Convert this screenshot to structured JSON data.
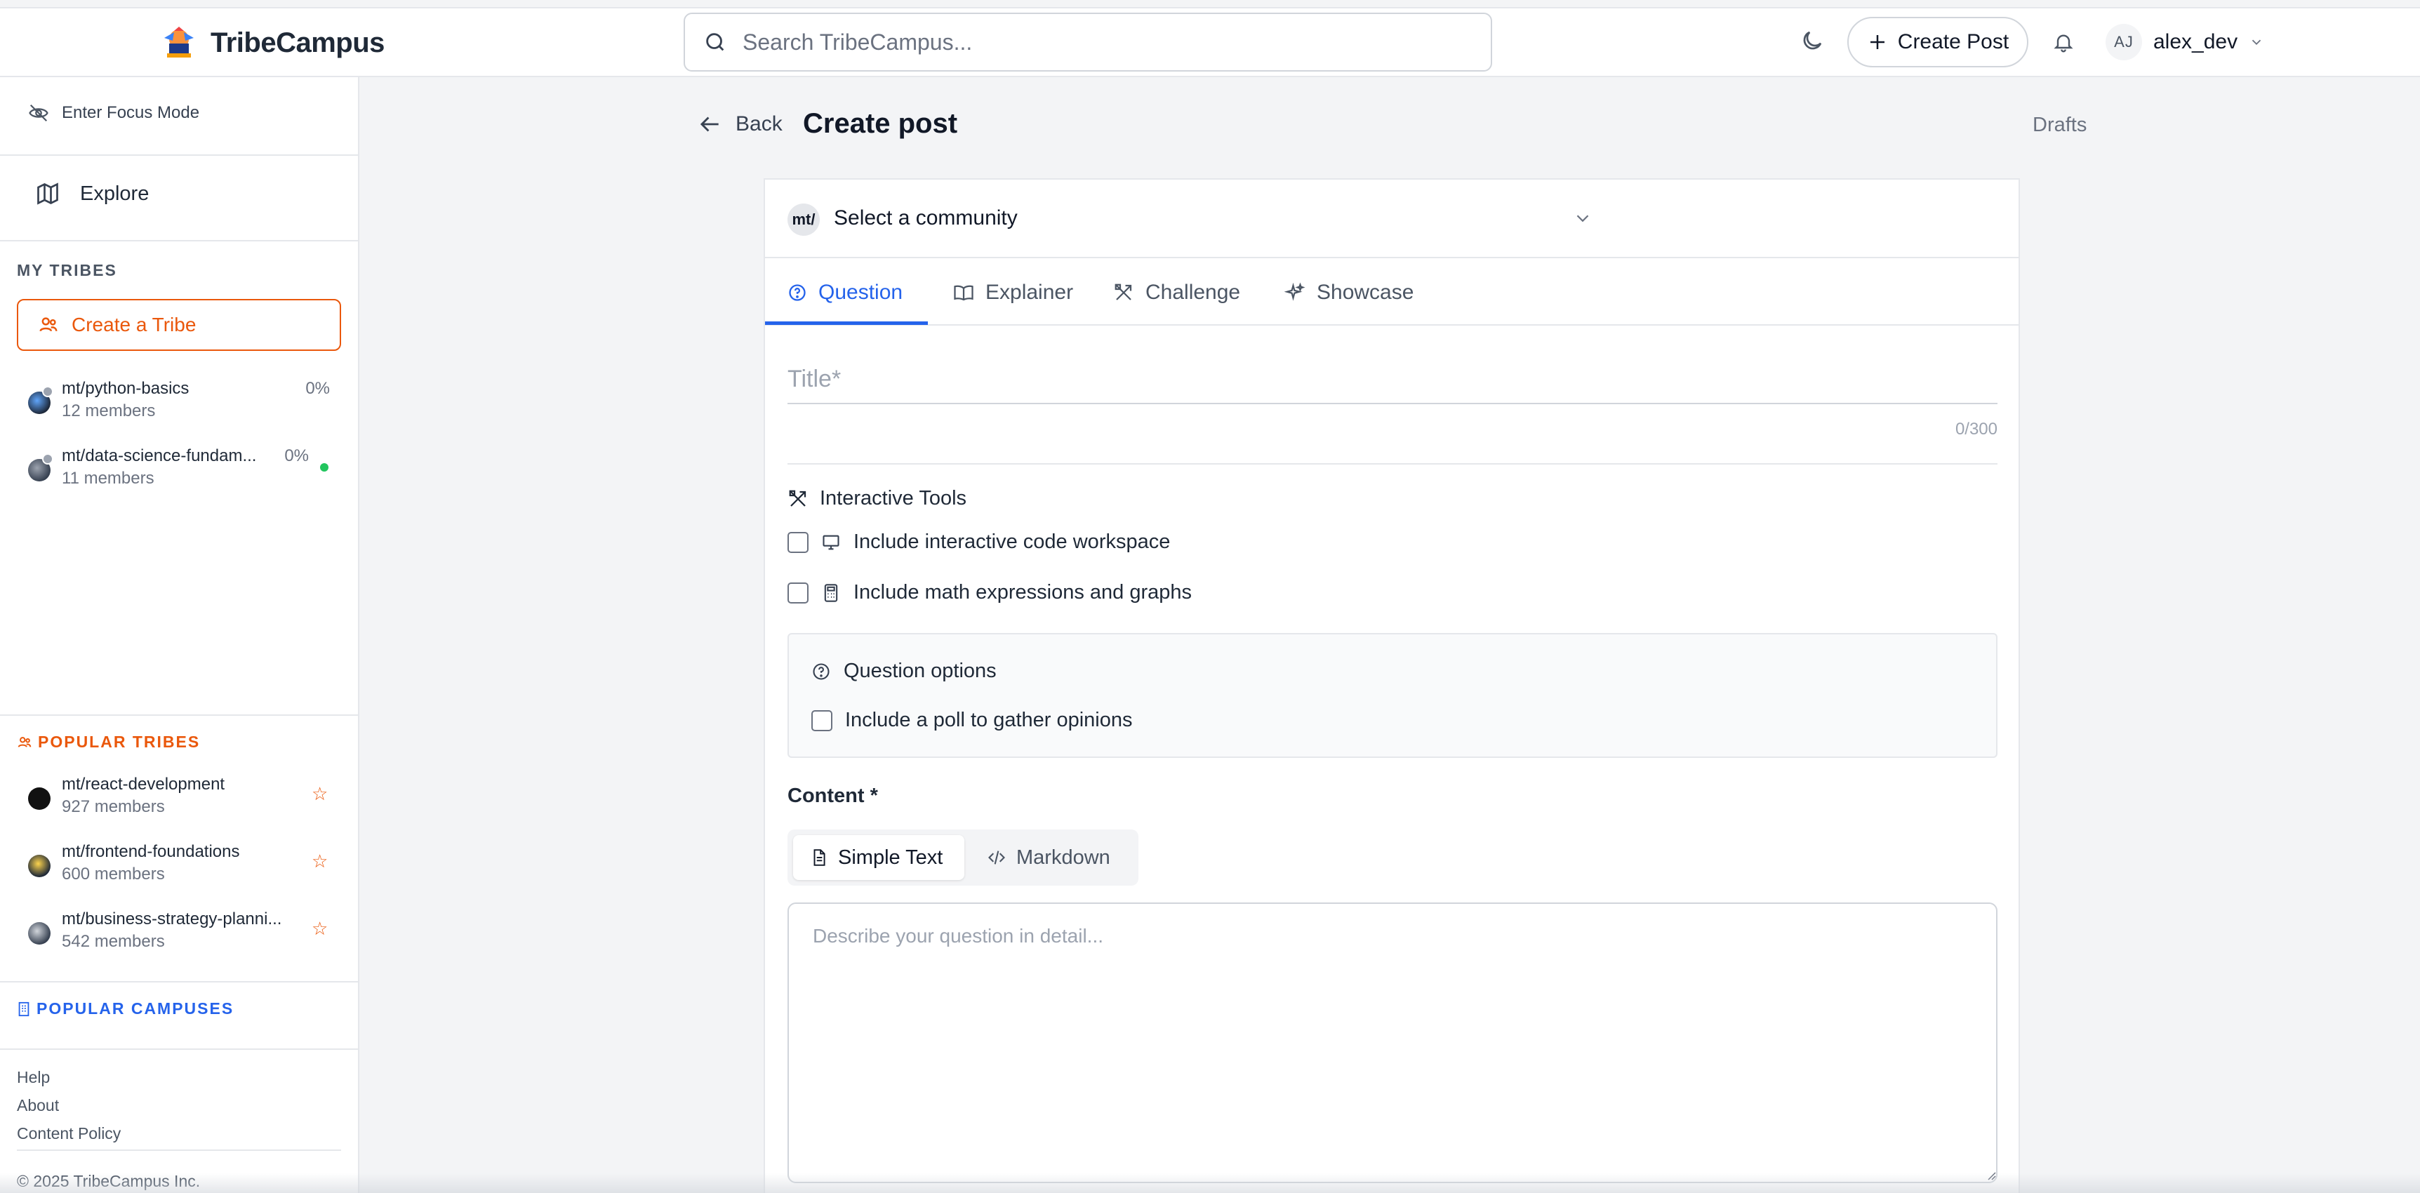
{
  "app": {
    "name": "TribeCampus",
    "search_placeholder": "Search TribeCampus...",
    "create_post_label": "Create Post",
    "user": {
      "initials": "AJ",
      "username": "alex_dev"
    }
  },
  "sidebar": {
    "focus_mode_label": "Enter Focus Mode",
    "explore_label": "Explore",
    "my_tribes_title": "MY TRIBES",
    "create_tribe_label": "Create a Tribe",
    "my_tribes": [
      {
        "name": "mt/python-basics",
        "members": "12 members",
        "progress": "0%"
      },
      {
        "name": "mt/data-science-fundam...",
        "members": "11 members",
        "progress": "0%"
      }
    ],
    "popular_tribes_title": "POPULAR TRIBES",
    "popular_tribes": [
      {
        "name": "mt/react-development",
        "members": "927 members"
      },
      {
        "name": "mt/frontend-foundations",
        "members": "600 members"
      },
      {
        "name": "mt/business-strategy-planni...",
        "members": "542 members"
      }
    ],
    "popular_campuses_title": "POPULAR CAMPUSES",
    "footer_links": [
      "Help",
      "About",
      "Content Policy"
    ],
    "copyright": "© 2025 TribeCampus Inc."
  },
  "main": {
    "back_label": "Back",
    "page_title": "Create post",
    "drafts_label": "Drafts",
    "community_badge": "mt/",
    "community_placeholder": "Select a community",
    "tabs": [
      {
        "label": "Question",
        "icon": "question-circle-icon",
        "active": true
      },
      {
        "label": "Explainer",
        "icon": "book-open-icon",
        "active": false
      },
      {
        "label": "Challenge",
        "icon": "tools-icon",
        "active": false
      },
      {
        "label": "Showcase",
        "icon": "sparkles-icon",
        "active": false
      }
    ],
    "title_placeholder": "Title*",
    "title_counter": "0/300",
    "interactive_tools_title": "Interactive Tools",
    "tools": [
      {
        "label": "Include interactive code workspace",
        "icon": "monitor-icon",
        "checked": false
      },
      {
        "label": "Include math expressions and graphs",
        "icon": "calculator-icon",
        "checked": false
      }
    ],
    "question_options_title": "Question options",
    "poll_label": "Include a poll to gather opinions",
    "content_label": "Content *",
    "editor_modes": [
      {
        "label": "Simple Text",
        "active": true
      },
      {
        "label": "Markdown",
        "active": false
      }
    ],
    "content_placeholder": "Describe your question in detail..."
  },
  "colors": {
    "accent_blue": "#2563eb",
    "accent_orange": "#ea580c",
    "online_green": "#22c55e"
  }
}
